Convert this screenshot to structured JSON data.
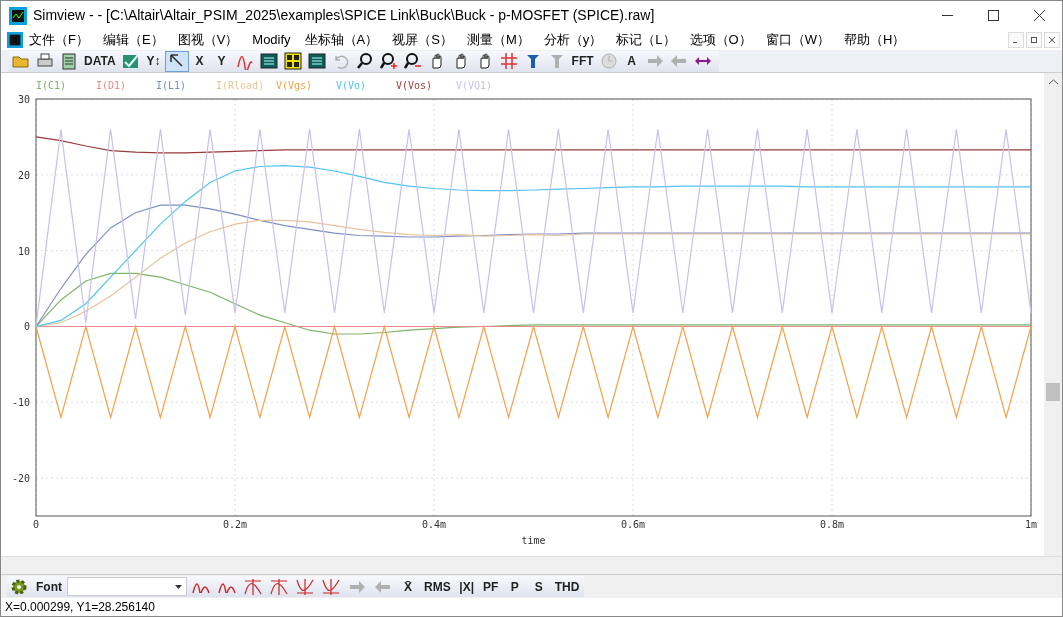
{
  "window": {
    "title": "Simview -  - [C:\\Altair\\Altair_PSIM_2025\\examples\\SPICE Link\\Buck\\Buck - p-MOSFET (SPICE).raw]"
  },
  "menu": [
    "文件（F）",
    "编辑（E）",
    "图视（V）",
    "Modify",
    "坐标轴（A）",
    "视屏（S）",
    "测量（M）",
    "分析（y）",
    "标记（L）",
    "选项（O）",
    "窗口（W）",
    "帮助（H）"
  ],
  "toolbar": [
    {
      "kind": "icon"
    },
    {
      "kind": "icon"
    },
    {
      "kind": "icon"
    },
    {
      "kind": "text",
      "label": "DATA"
    },
    {
      "kind": "icon"
    },
    {
      "kind": "text",
      "label": "Y↕"
    },
    {
      "kind": "icon",
      "selected": true
    },
    {
      "kind": "text",
      "label": "X"
    },
    {
      "kind": "text",
      "label": "Y"
    },
    {
      "kind": "icon"
    },
    {
      "kind": "icon"
    },
    {
      "kind": "icon"
    },
    {
      "kind": "icon"
    },
    {
      "kind": "icon",
      "disabled": true
    },
    {
      "kind": "icon"
    },
    {
      "kind": "icon"
    },
    {
      "kind": "icon"
    },
    {
      "kind": "icon"
    },
    {
      "kind": "icon"
    },
    {
      "kind": "icon"
    },
    {
      "kind": "icon"
    },
    {
      "kind": "icon"
    },
    {
      "kind": "icon",
      "disabled": true
    },
    {
      "kind": "text",
      "label": "FFT"
    },
    {
      "kind": "icon",
      "disabled": true
    },
    {
      "kind": "text",
      "label": "A"
    },
    {
      "kind": "icon",
      "disabled": true
    },
    {
      "kind": "icon",
      "disabled": true
    },
    {
      "kind": "icon"
    }
  ],
  "chart_data": {
    "type": "line",
    "grid": true,
    "xlabel": "time",
    "xlim": [
      0,
      1
    ],
    "ylim": [
      -25,
      30
    ],
    "xticks": [
      {
        "value": 0,
        "label": "0"
      },
      {
        "value": 0.2,
        "label": "0.2m"
      },
      {
        "value": 0.4,
        "label": "0.4m"
      },
      {
        "value": 0.6,
        "label": "0.6m"
      },
      {
        "value": 0.8,
        "label": "0.8m"
      },
      {
        "value": 1,
        "label": "1m"
      }
    ],
    "yticks": [
      -20,
      -10,
      0,
      10,
      20,
      30
    ],
    "x": [
      0,
      0.025,
      0.05,
      0.075,
      0.1,
      0.125,
      0.15,
      0.175,
      0.2,
      0.225,
      0.25,
      0.275,
      0.3,
      0.325,
      0.35,
      0.375,
      0.4,
      0.425,
      0.45,
      0.475,
      0.5,
      0.525,
      0.55,
      0.575,
      0.6,
      0.625,
      0.65,
      0.675,
      0.7,
      0.725,
      0.75,
      0.775,
      0.8,
      0.825,
      0.85,
      0.875,
      0.9,
      0.925,
      0.95,
      0.975,
      1
    ],
    "series": [
      {
        "name": "I(C1)",
        "color": "#7db36a",
        "values": [
          0,
          3.5,
          6,
          7,
          7,
          6.5,
          5.5,
          4.5,
          3,
          1.5,
          0.5,
          -0.5,
          -1,
          -1,
          -0.8,
          -0.5,
          -0.3,
          -0.1,
          0,
          0.1,
          0.2,
          0.2,
          0.2,
          0.2,
          0.2,
          0.2,
          0.2,
          0.2,
          0.2,
          0.2,
          0.2,
          0.2,
          0.2,
          0.2,
          0.2,
          0.2,
          0.2,
          0.2,
          0.2,
          0.2,
          0.2
        ]
      },
      {
        "name": "I(D1)",
        "color": "#e88a8a",
        "values": [
          0,
          0,
          0,
          0,
          0,
          0,
          0,
          0,
          0,
          0,
          0,
          0,
          0,
          0,
          0,
          0,
          0,
          0,
          0,
          0,
          0,
          0,
          0,
          0,
          0,
          0,
          0,
          0,
          0,
          0,
          0,
          0,
          0,
          0,
          0,
          0,
          0,
          0,
          0,
          0,
          0
        ]
      },
      {
        "name": "I(L1)",
        "color": "#7f8fc4",
        "values": [
          0,
          5,
          9.5,
          13,
          15,
          16,
          16,
          15.5,
          14.8,
          14,
          13.3,
          12.8,
          12.3,
          12,
          11.9,
          11.8,
          11.8,
          11.9,
          12,
          12.1,
          12.2,
          12.2,
          12.3,
          12.3,
          12.3,
          12.3,
          12.3,
          12.3,
          12.3,
          12.3,
          12.3,
          12.3,
          12.3,
          12.3,
          12.3,
          12.3,
          12.3,
          12.3,
          12.3,
          12.3,
          12.3
        ]
      },
      {
        "name": "I(Rload)",
        "color": "#e8c49a",
        "values": [
          0,
          0.5,
          2,
          4,
          6.5,
          9,
          11,
          12.5,
          13.5,
          14,
          14,
          13.8,
          13.3,
          12.8,
          12.4,
          12.1,
          12,
          12.1,
          11.9,
          12,
          12.1,
          12,
          12.2,
          12.2,
          12.2,
          12.2,
          12.2,
          12.2,
          12.2,
          12.2,
          12.2,
          12.2,
          12.2,
          12.2,
          12.2,
          12.2,
          12.2,
          12.2,
          12.2,
          12.2,
          12.2
        ]
      },
      {
        "name": "V(Vgs)",
        "color": "#f5a04a",
        "values": [
          0,
          -12,
          0,
          -12,
          0,
          -12,
          0,
          -12,
          0,
          -12,
          0,
          -12,
          0,
          -12,
          0,
          -12,
          0,
          -12,
          0,
          -12,
          0,
          -12,
          0,
          -12,
          0,
          -12,
          0,
          -12,
          0,
          -12,
          0,
          -12,
          0,
          -12,
          0,
          -12,
          0,
          -12,
          0,
          -12,
          0
        ]
      },
      {
        "name": "V(Vo)",
        "color": "#4fc3f0",
        "values": [
          0,
          0.8,
          3,
          6.5,
          10,
          13.5,
          16.5,
          19,
          20.5,
          21.1,
          21.2,
          21,
          20.5,
          19.8,
          19,
          18.5,
          18.2,
          18,
          17.9,
          17.9,
          18,
          18.1,
          18.2,
          18.3,
          18.4,
          18.4,
          18.5,
          18.5,
          18.5,
          18.5,
          18.5,
          18.4,
          18.4,
          18.4,
          18.4,
          18.4,
          18.4,
          18.4,
          18.4,
          18.4,
          18.4
        ]
      },
      {
        "name": "V(Vos)",
        "color": "#9a3b3b",
        "values": [
          25,
          24.5,
          23.8,
          23.2,
          23,
          22.9,
          22.9,
          23,
          23.1,
          23.2,
          23.3,
          23.3,
          23.3,
          23.3,
          23.3,
          23.3,
          23.3,
          23.3,
          23.3,
          23.3,
          23.3,
          23.3,
          23.3,
          23.3,
          23.3,
          23.3,
          23.3,
          23.3,
          23.3,
          23.3,
          23.3,
          23.3,
          23.3,
          23.3,
          23.3,
          23.3,
          23.3,
          23.3,
          23.3,
          23.3,
          23.3
        ]
      },
      {
        "name": "V(VQ1)",
        "color": "#c9c0ec",
        "values": [
          0,
          26,
          0.5,
          26,
          1,
          26,
          1.5,
          26,
          1.8,
          26,
          1.8,
          26,
          1.8,
          26,
          1.8,
          26,
          1.8,
          26,
          1.8,
          26,
          1.8,
          26,
          1.8,
          26,
          1.8,
          26,
          1.8,
          26,
          1.8,
          26,
          1.8,
          26,
          1.8,
          26,
          1.8,
          26,
          1.8,
          26,
          1.8,
          26,
          1.8
        ]
      }
    ]
  },
  "bottom_toolbar": [
    {
      "kind": "icon"
    },
    {
      "kind": "text",
      "label": "Font"
    },
    {
      "kind": "dropdown"
    },
    {
      "kind": "icon"
    },
    {
      "kind": "icon"
    },
    {
      "kind": "icon"
    },
    {
      "kind": "icon"
    },
    {
      "kind": "icon"
    },
    {
      "kind": "icon"
    },
    {
      "kind": "icon",
      "disabled": true
    },
    {
      "kind": "icon",
      "disabled": true
    },
    {
      "kind": "text",
      "label": "X̄"
    },
    {
      "kind": "text",
      "label": "RMS"
    },
    {
      "kind": "text",
      "label": "|X|"
    },
    {
      "kind": "text",
      "label": "PF"
    },
    {
      "kind": "text",
      "label": "P"
    },
    {
      "kind": "text",
      "label": "S"
    },
    {
      "kind": "text",
      "label": "THD"
    }
  ],
  "status_bar": "X=0.000299, Y1=28.256140"
}
